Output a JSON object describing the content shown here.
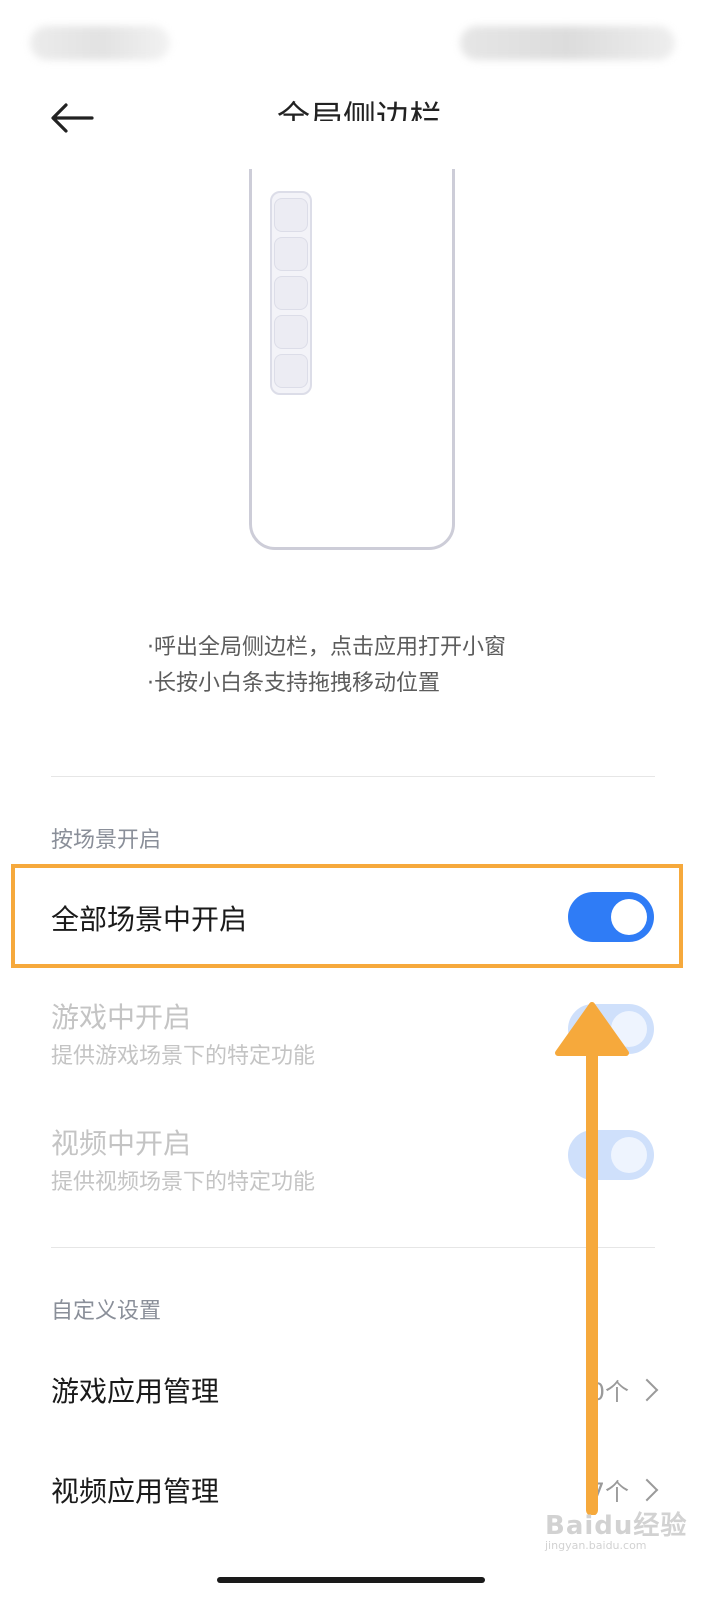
{
  "header": {
    "title": "全局侧边栏"
  },
  "description": {
    "line1": "·呼出全局侧边栏，点击应用打开小窗",
    "line2": "·长按小白条支持拖拽移动位置"
  },
  "scene_section": {
    "label": "按场景开启",
    "items": [
      {
        "title": "全部场景中开启",
        "subtitle": "",
        "enabled": true,
        "active": true
      },
      {
        "title": "游戏中开启",
        "subtitle": "提供游戏场景下的特定功能",
        "enabled": true,
        "active": false
      },
      {
        "title": "视频中开启",
        "subtitle": "提供视频场景下的特定功能",
        "enabled": true,
        "active": false
      }
    ]
  },
  "custom_section": {
    "label": "自定义设置",
    "items": [
      {
        "title": "游戏应用管理",
        "count": "0个"
      },
      {
        "title": "视频应用管理",
        "count": "7个"
      }
    ]
  },
  "watermark": {
    "main": "Baidu经验",
    "sub": "jingyan.baidu.com"
  },
  "colors": {
    "accent": "#2f7cf6",
    "highlight": "#f6a93c",
    "disabled_toggle": "#cfe0fb"
  }
}
